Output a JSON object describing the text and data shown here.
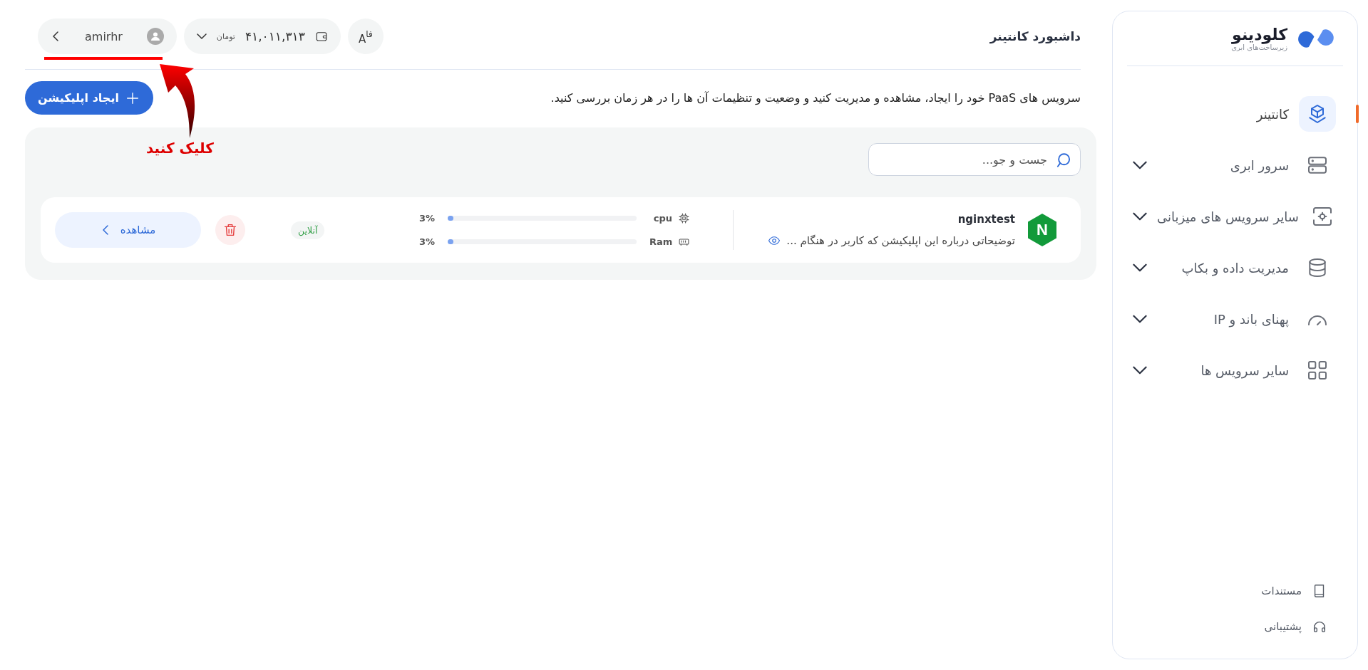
{
  "sidebar": {
    "logo": {
      "name": "کلودینو",
      "tagline": "زیرساخت‌های ابری"
    },
    "items": [
      {
        "label": "کانتینر",
        "kind": "link",
        "selected": true
      },
      {
        "label": "سرور ابری",
        "kind": "group",
        "selected": false
      },
      {
        "label": "سایر سرویس های میزبانی",
        "kind": "group",
        "selected": false
      },
      {
        "label": "مدیریت داده و بکاپ",
        "kind": "group",
        "selected": false
      },
      {
        "label": "پهنای باند و IP",
        "kind": "group",
        "selected": false
      },
      {
        "label": "سایر سرویس ها",
        "kind": "group",
        "selected": false
      }
    ],
    "footer_items": [
      {
        "label": "مستندات"
      },
      {
        "label": "پشتیبانی"
      }
    ]
  },
  "header": {
    "title": "داشبورد کانتینر",
    "language_button": [
      "فا",
      "A"
    ],
    "balance": {
      "amount": "۴۱,۰۱۱,۳۱۳",
      "currency": "تومان"
    },
    "user": {
      "name": "amirhr"
    }
  },
  "description": "سرویس های PaaS خود را ایجاد، مشاهده و مدیریت کنید و وضعیت و تنظیمات آن ها را در هر زمان بررسی کنید.",
  "create_button": {
    "label": "ایجاد اپلیکیشن"
  },
  "search": {
    "placeholder": "جست و جو..."
  },
  "apps": [
    {
      "icon_letter": "N",
      "name": "nginxtest",
      "description": "توضیحاتی درباره این اپلیکیشن که کاربر در هنگام ...",
      "meters": [
        {
          "label": "cpu",
          "level": 0.03,
          "reading": "3%"
        },
        {
          "label": "Ram",
          "level": 0.03,
          "reading": "3%"
        }
      ],
      "status": "آنلاین",
      "view_label": "مشاهده"
    }
  ],
  "annotation": {
    "text": "کلیک کنید"
  }
}
